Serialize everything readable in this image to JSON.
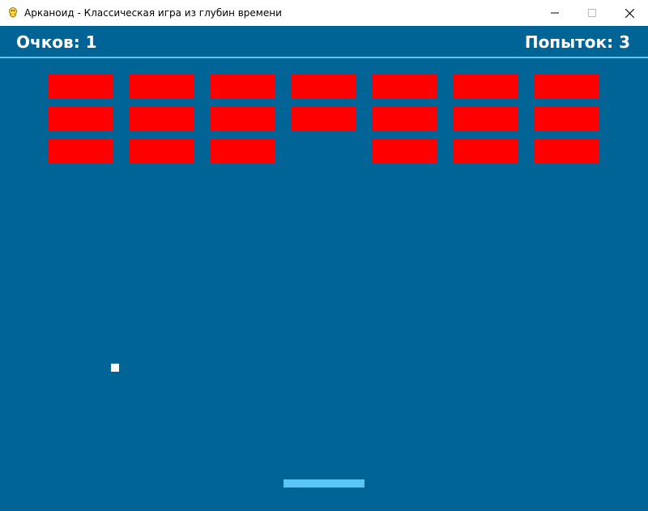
{
  "window": {
    "title": "Арканоид - Классическая игра из глубин времени",
    "app_icon": "python-snake-icon",
    "controls": [
      "minimize-icon",
      "maximize-icon",
      "close-icon"
    ]
  },
  "hud": {
    "score_label": "Очков:",
    "score_value": "1",
    "score_text": "Очков: 1",
    "lives_label": "Попыток:",
    "lives_value": "3",
    "lives_text": "Попыток: 3"
  },
  "bricks": {
    "rows": 3,
    "columns": 7,
    "grid": [
      [
        1,
        1,
        1,
        1,
        1,
        1,
        1
      ],
      [
        1,
        1,
        1,
        1,
        1,
        1,
        1
      ],
      [
        1,
        1,
        1,
        0,
        1,
        1,
        1
      ]
    ],
    "remaining": 20
  },
  "colors": {
    "background": "#006596",
    "brick": "#ff0000",
    "paddle": "#5bc6f5",
    "hud_line": "#5bc6f5",
    "ball": "#ffffff",
    "text": "#ffffff"
  }
}
